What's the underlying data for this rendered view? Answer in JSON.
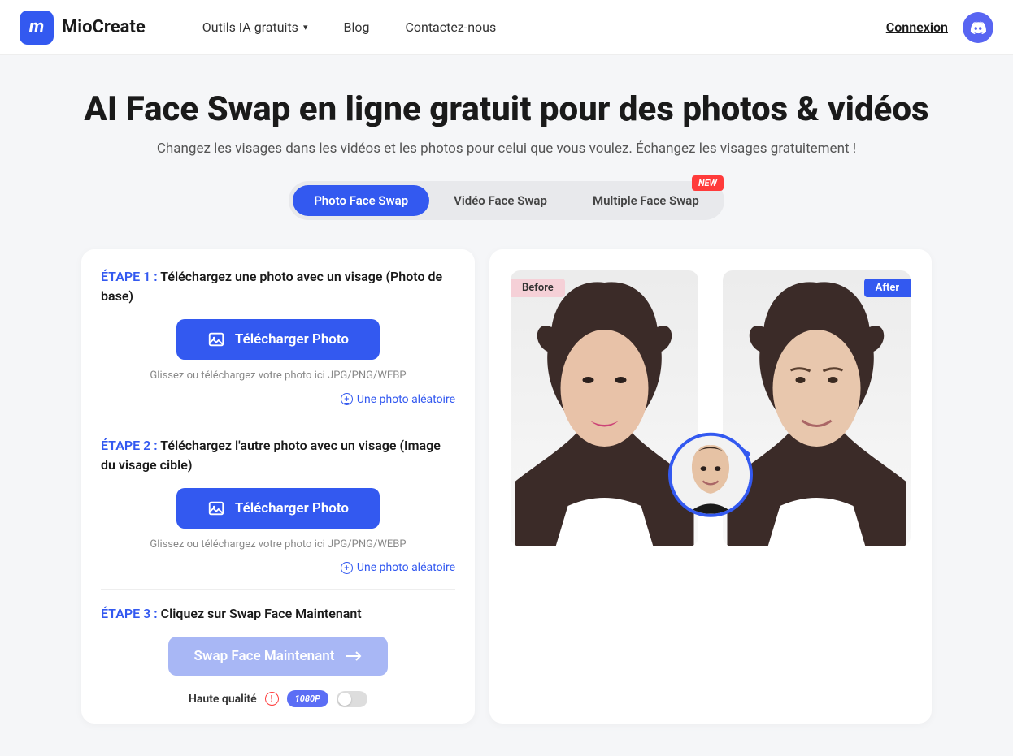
{
  "brand": {
    "name": "MioCreate",
    "mark": "m"
  },
  "nav": {
    "tools": "Outils IA gratuits",
    "blog": "Blog",
    "contact": "Contactez-nous"
  },
  "header": {
    "login": "Connexion"
  },
  "hero": {
    "title": "AI Face Swap en ligne gratuit pour des photos & vidéos",
    "subtitle": "Changez les visages dans les vidéos et les photos pour celui que vous voulez. Échangez les visages gratuitement !"
  },
  "tabs": {
    "photo": "Photo Face Swap",
    "video": "Vidéo Face Swap",
    "multi": "Multiple Face Swap",
    "new_badge": "NEW"
  },
  "steps": {
    "s1_label": "ÉTAPE 1 :",
    "s1_desc": " Téléchargez une photo avec un visage (Photo de base)",
    "s2_label": "ÉTAPE 2 :",
    "s2_desc": " Téléchargez l'autre photo avec un visage (Image du visage cible)",
    "s3_label": "ÉTAPE 3 :",
    "s3_desc": " Cliquez sur Swap Face Maintenant"
  },
  "upload": {
    "button": "Télécharger Photo",
    "hint": "Glissez ou téléchargez votre photo ici JPG/PNG/WEBP",
    "random": "Une photo aléatoire"
  },
  "action": {
    "swap": "Swap Face Maintenant"
  },
  "quality": {
    "label": "Haute qualité",
    "res": "1080P"
  },
  "preview": {
    "before": "Before",
    "after": "After"
  }
}
